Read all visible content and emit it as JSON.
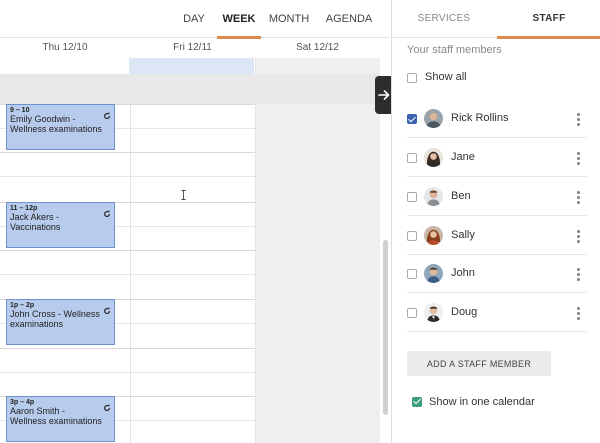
{
  "view_tabs": [
    {
      "label": "DAY",
      "active": false
    },
    {
      "label": "WEEK",
      "active": true
    },
    {
      "label": "MONTH",
      "active": false
    },
    {
      "label": "AGENDA",
      "active": false
    }
  ],
  "days": [
    "Thu 12/10",
    "Fri 12/11",
    "Sat 12/12"
  ],
  "events": [
    {
      "time": "9 – 10",
      "title": "Emily Goodwin - Wellness examinations"
    },
    {
      "time": "11 – 12p",
      "title": "Jack Akers - Vaccinations"
    },
    {
      "time": "1p – 2p",
      "title": "John Cross - Wellness examinations"
    },
    {
      "time": "3p – 4p",
      "title": "Aaron Smith - Wellness examinations"
    }
  ],
  "panel": {
    "tabs": [
      {
        "label": "SERVICES",
        "active": false
      },
      {
        "label": "STAFF",
        "active": true
      }
    ],
    "subtitle": "Your staff members",
    "show_all": "Show all",
    "staff": [
      {
        "name": "Rick Rollins",
        "checked": true
      },
      {
        "name": "Jane",
        "checked": false
      },
      {
        "name": "Ben",
        "checked": false
      },
      {
        "name": "Sally",
        "checked": false
      },
      {
        "name": "John",
        "checked": false
      },
      {
        "name": "Doug",
        "checked": false
      }
    ],
    "add_button": "ADD A STAFF MEMBER",
    "one_calendar": "Show in one calendar"
  },
  "colors": {
    "accent": "#d98b4f",
    "event_fill": "#b7cbec",
    "event_border": "#6e93c8",
    "checkbox_checked": "#3a62b0",
    "one_calendar_check": "#3e9c7e",
    "today_highlight": "#dce6f5"
  }
}
